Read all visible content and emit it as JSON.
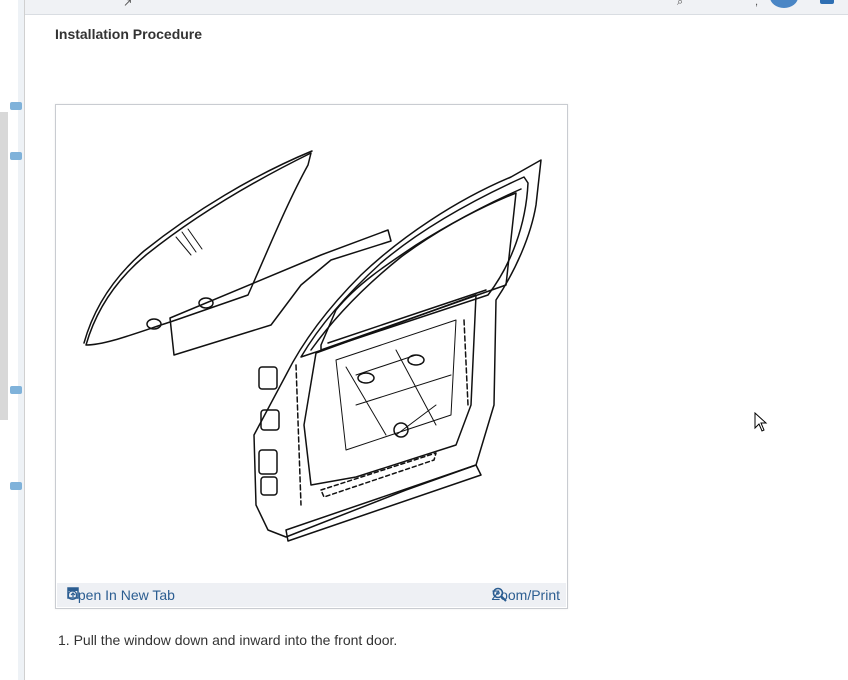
{
  "section": {
    "heading": "Installation Procedure"
  },
  "figure": {
    "open_new_tab_label": "Open In New Tab",
    "zoom_print_label": "Zoom/Print"
  },
  "steps": [
    {
      "text": "1. Pull the window down and inward into the front door."
    }
  ],
  "colors": {
    "link": "#2b5d91",
    "avatar": "#4a86c5",
    "footer_bg": "#eef0f4"
  },
  "icons": [
    "open-in-new-tab-icon",
    "zoom-icon",
    "cursor-icon",
    "avatar"
  ]
}
